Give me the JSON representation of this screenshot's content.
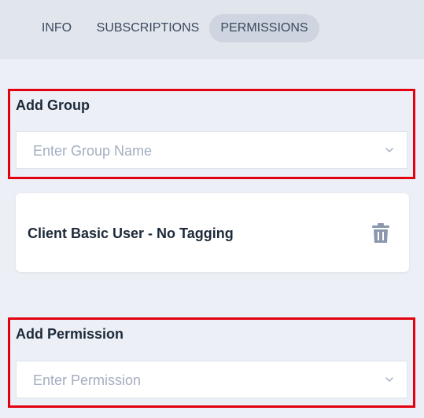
{
  "tabs": [
    {
      "label": "INFO",
      "active": false
    },
    {
      "label": "SUBSCRIPTIONS",
      "active": false
    },
    {
      "label": "PERMISSIONS",
      "active": true
    }
  ],
  "add_group": {
    "label": "Add Group",
    "placeholder": "Enter Group Name"
  },
  "groups": [
    {
      "name": "Client Basic User - No Tagging",
      "action_icon": "trash-icon"
    }
  ],
  "add_permission": {
    "label": "Add Permission",
    "placeholder": "Enter Permission"
  },
  "colors": {
    "page_background": "#eceff5",
    "tabbar_background": "#e1e5ec",
    "active_tab": "#ced4e0",
    "highlight_border": "#e3000f",
    "placeholder_text": "#a3aec0",
    "icon_gray": "#8a97ac"
  }
}
